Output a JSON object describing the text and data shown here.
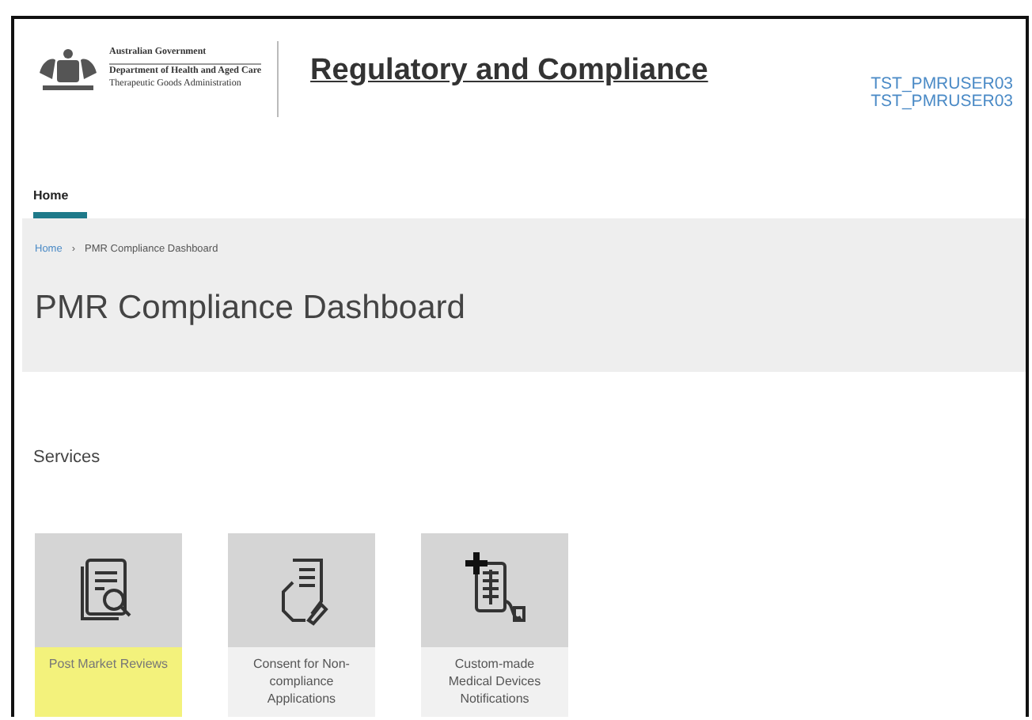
{
  "header": {
    "agency_lines": [
      "Australian Government",
      "Department of Health and Aged Care",
      "Therapeutic Goods Administration"
    ],
    "title": "Regulatory and Compliance",
    "user_lines": [
      "TST_PMRUSER03",
      "TST_PMRUSER03"
    ]
  },
  "nav": [
    {
      "label": "Home",
      "selected": true
    }
  ],
  "breadcrumb": {
    "items": [
      "Home",
      "PMR Compliance Dashboard"
    ],
    "separator": "›"
  },
  "page_title": "PMR Compliance Dashboard",
  "services": {
    "heading": "Services",
    "tiles": [
      {
        "kind": "review",
        "label": "Post Market Reviews",
        "selected": true
      },
      {
        "kind": "consent",
        "label": "Consent for Non-compliance Applications",
        "selected": false
      },
      {
        "kind": "device",
        "label": "Custom-made Medical Devices Notifications",
        "selected": false
      }
    ]
  }
}
